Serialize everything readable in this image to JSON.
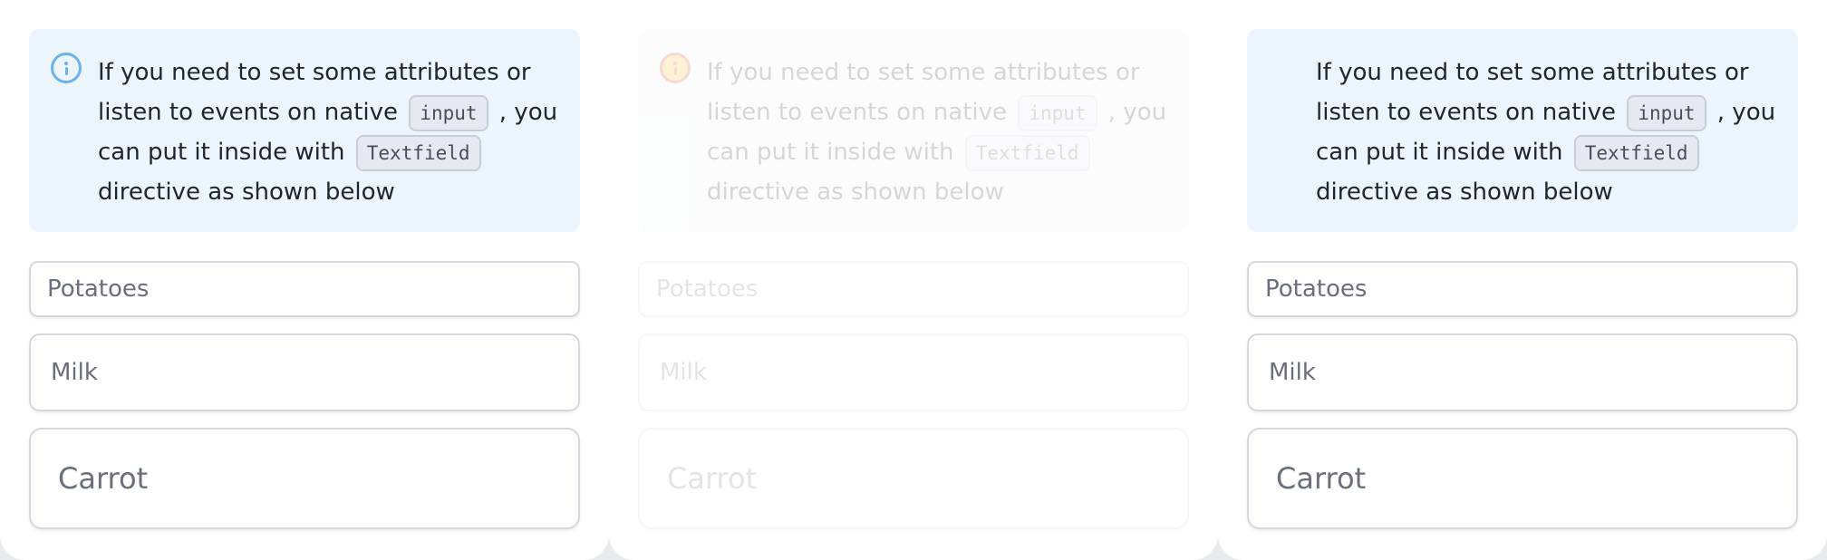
{
  "panels": [
    {
      "icon": "info-circle-icon",
      "alert": {
        "line1": "If you need to set some attributes or",
        "line2_pre": "listen to events on native",
        "code1": "input",
        "line2_post": ", you",
        "line3_pre": "can put it inside with",
        "code2": "Textfield",
        "line4": "directive as shown below"
      },
      "fields": [
        "Potatoes",
        "Milk",
        "Carrot"
      ]
    },
    {
      "icon": "warning-circle-icon",
      "alert": {
        "line1": "If you need to set some attributes or",
        "line2_pre": "listen to events on native",
        "code1": "input",
        "line2_post": ", you",
        "line3_pre": "can put it inside with",
        "code2": "Textfield",
        "line4": "directive as shown below"
      },
      "fields": [
        "Potatoes",
        "Milk",
        "Carrot"
      ]
    },
    {
      "icon": "none",
      "alert": {
        "line1": "If you need to set some attributes or",
        "line2_pre": "listen to events on native",
        "code1": "input",
        "line2_post": ", you",
        "line3_pre": "can put it inside with",
        "code2": "Textfield",
        "line4": "directive as shown below"
      },
      "fields": [
        "Potatoes",
        "Milk",
        "Carrot"
      ]
    }
  ],
  "colors": {
    "alert_bg": "#ecf4fc",
    "info_icon": "#6bb2ee",
    "warning_icon_ring": "#d92d0c",
    "warning_icon_fill": "#f7c21a",
    "text": "#222431",
    "field_text": "#6b6e7c"
  }
}
